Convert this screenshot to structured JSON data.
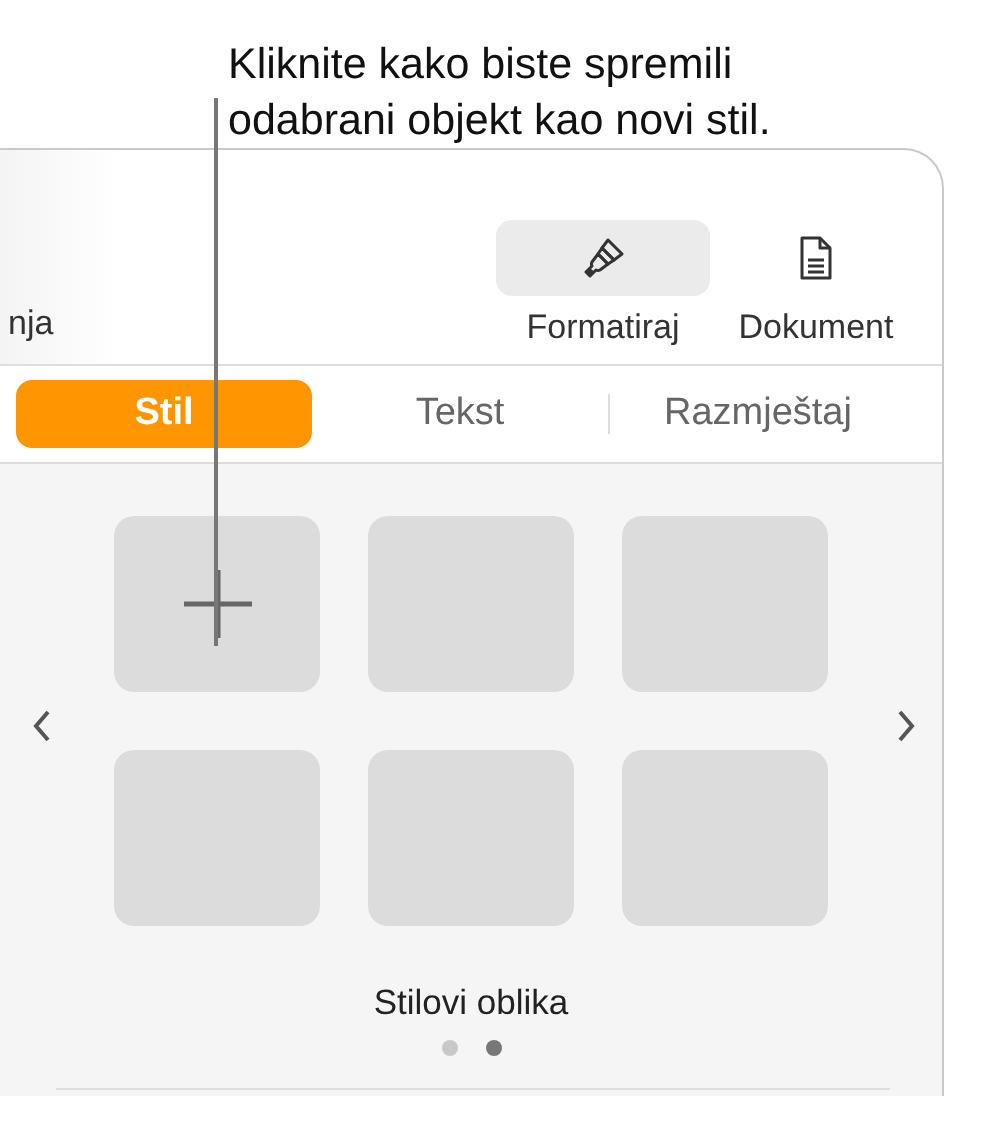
{
  "callout": {
    "lines": [
      "Kliknite kako biste spremili",
      "odabrani objekt kao novi stil."
    ]
  },
  "toolbar": [
    {
      "kind": "text",
      "label": "nja"
    },
    {
      "kind": "brush",
      "label": "Formatiraj",
      "selected": true
    },
    {
      "kind": "document",
      "label": "Dokument",
      "selected": false
    }
  ],
  "tabs": [
    {
      "label": "Stil",
      "selected": true
    },
    {
      "label": "Tekst",
      "selected": false
    },
    {
      "label": "Razmještaj",
      "selected": false
    }
  ],
  "styles": [
    {
      "kind": "add"
    },
    {
      "kind": "empty"
    },
    {
      "kind": "empty"
    },
    {
      "kind": "empty"
    },
    {
      "kind": "empty"
    },
    {
      "kind": "empty"
    }
  ],
  "caption": "Stilovi oblika",
  "pages": [
    {
      "selected": false
    },
    {
      "selected": true
    }
  ]
}
